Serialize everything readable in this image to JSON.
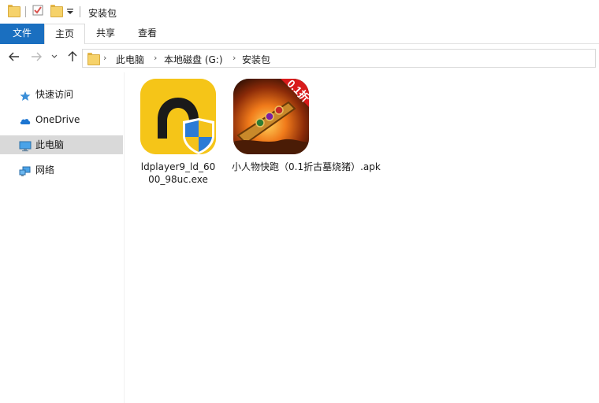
{
  "titlebar": {
    "title": "安装包"
  },
  "ribbon": {
    "tabs": [
      "文件",
      "主页",
      "共享",
      "查看"
    ]
  },
  "navbar": {
    "back_icon": "arrow-left-icon",
    "forward_icon": "arrow-right-icon",
    "recent_icon": "chevron-down-icon",
    "up_icon": "arrow-up-icon",
    "breadcrumbs": [
      "此电脑",
      "本地磁盘 (G:)",
      "安装包"
    ]
  },
  "sidebar": {
    "items": [
      {
        "label": "快速访问",
        "icon": "star-icon"
      },
      {
        "label": "OneDrive",
        "icon": "cloud-icon"
      },
      {
        "label": "此电脑",
        "icon": "monitor-icon"
      },
      {
        "label": "网络",
        "icon": "network-icon"
      }
    ]
  },
  "files": [
    {
      "name_line1": "ldplayer9_ld_60",
      "name_line2": "00_98uc.exe",
      "icon": "ldplayer-app-icon"
    },
    {
      "name": "小人物快跑（0.1折古墓烧猪）.apk",
      "icon": "game-apk-icon",
      "badge": "0.1折"
    }
  ],
  "colors": {
    "file_tab": "#1a6fc0",
    "selected_nav": "#d9d9d9",
    "ldplayer_bg": "#f5c518"
  }
}
